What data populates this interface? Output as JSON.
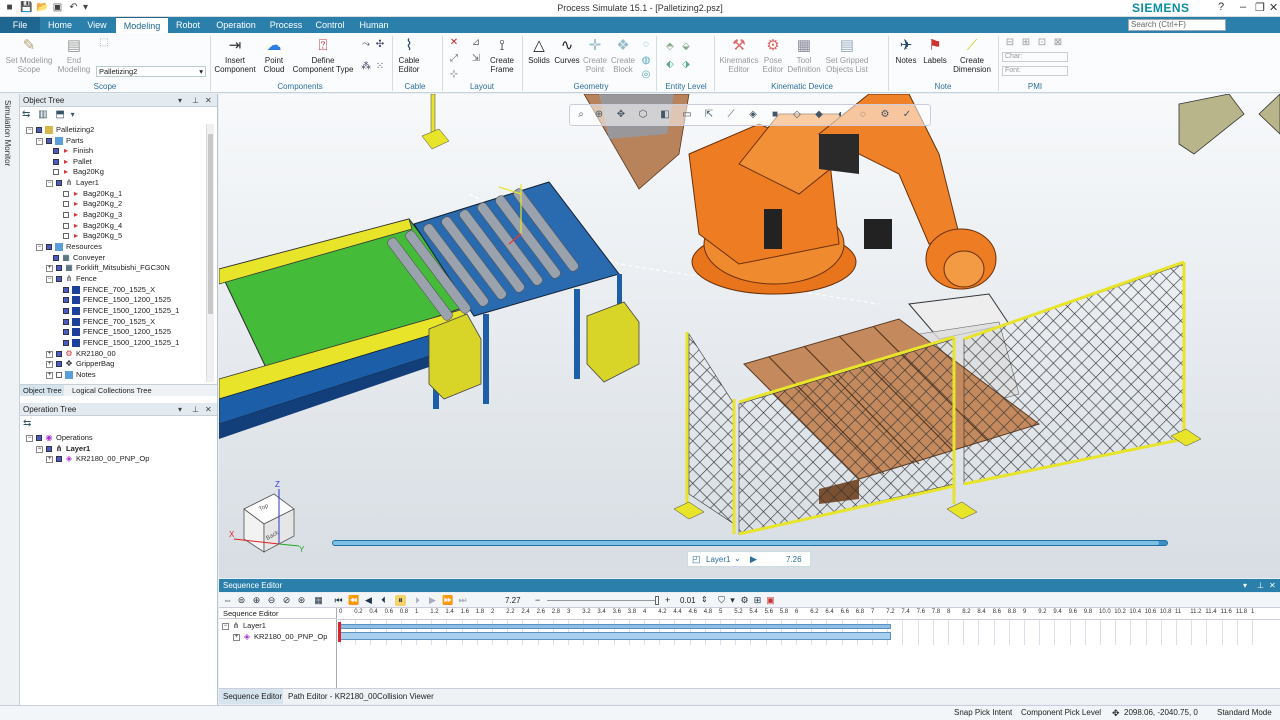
{
  "window": {
    "title": "Process Simulate 15.1 - [Palletizing2.psz]",
    "brand": "SIEMENS"
  },
  "tabs": [
    {
      "label": "File"
    },
    {
      "label": "Home"
    },
    {
      "label": "View"
    },
    {
      "label": "Modeling"
    },
    {
      "label": "Robot"
    },
    {
      "label": "Operation"
    },
    {
      "label": "Process"
    },
    {
      "label": "Control"
    },
    {
      "label": "Human"
    }
  ],
  "search": {
    "placeholder": "Search (Ctrl+F)"
  },
  "ribbon": {
    "scope": {
      "set": "Set Modeling Scope",
      "end": "End Modeling",
      "dropdown": "Palletizing2",
      "group": "Scope"
    },
    "components": {
      "insert": "Insert Component",
      "point_cloud": "Point Cloud",
      "define": "Define Component Type",
      "group": "Components"
    },
    "cable": {
      "editor": "Cable Editor",
      "group": "Cable"
    },
    "layout": {
      "create_frame": "Create Frame",
      "group": "Layout"
    },
    "geometry": {
      "solids": "Solids",
      "curves": "Curves",
      "create_point": "Create Point",
      "create_block": "Create Block",
      "group": "Geometry"
    },
    "entity": {
      "group": "Entity Level"
    },
    "kinematic": {
      "editor": "Kinematics Editor",
      "pose": "Pose Editor",
      "tool": "Tool Definition",
      "gripped": "Set Gripped Objects List",
      "group": "Kinematic Device"
    },
    "note": {
      "notes": "Notes",
      "labels": "Labels",
      "dimension": "Create Dimension",
      "group": "Note"
    },
    "pmi": {
      "char": "Char:",
      "font": "Font:",
      "group": "PMI"
    }
  },
  "side_tab": "Simulation Monitor",
  "object_tree": {
    "title": "Object Tree",
    "rows": [
      {
        "label": "Palletizing2"
      },
      {
        "label": "Parts"
      },
      {
        "label": "Finish"
      },
      {
        "label": "Pallet"
      },
      {
        "label": "Bag20Kg"
      },
      {
        "label": "Layer1"
      },
      {
        "label": "Bag20Kg_1"
      },
      {
        "label": "Bag20Kg_2"
      },
      {
        "label": "Bag20Kg_3"
      },
      {
        "label": "Bag20Kg_4"
      },
      {
        "label": "Bag20Kg_5"
      },
      {
        "label": "Resources"
      },
      {
        "label": "Conveyer"
      },
      {
        "label": "Forklift_Mitsubishi_FGC30N"
      },
      {
        "label": "Fence"
      },
      {
        "label": "FENCE_700_1525_X"
      },
      {
        "label": "FENCE_1500_1200_1525"
      },
      {
        "label": "FENCE_1500_1200_1525_1"
      },
      {
        "label": "FENCE_700_1525_X"
      },
      {
        "label": "FENCE_1500_1200_1525"
      },
      {
        "label": "FENCE_1500_1200_1525_1"
      },
      {
        "label": "KR2180_00"
      },
      {
        "label": "GripperBag"
      },
      {
        "label": "Notes"
      }
    ],
    "tabs": [
      "Object Tree",
      "Logical Collections Tree"
    ]
  },
  "operation_tree": {
    "title": "Operation Tree",
    "rows": [
      {
        "label": "Operations"
      },
      {
        "label": "Layer1"
      },
      {
        "label": "KR2180_00_PNP_Op"
      }
    ]
  },
  "viewport": {
    "sim_panel": {
      "operation": "Layer1",
      "time": "7.26"
    },
    "progress": 0.99,
    "cube_labels": {
      "top": "Top",
      "back": "Back"
    },
    "axes": {
      "x": "X",
      "y": "Y",
      "z": "Z"
    }
  },
  "sequence_editor": {
    "title": "Sequence Editor",
    "time_value": "7.27",
    "step_value": "0.01",
    "column_header": "Sequence Editor",
    "ticks": [
      "0",
      "0.2",
      "0.4",
      "0.6",
      "0.8",
      "1",
      "1.2",
      "1.4",
      "1.6",
      "1.8",
      "2",
      "2.2",
      "2.4",
      "2.6",
      "2.8",
      "3",
      "3.2",
      "3.4",
      "3.6",
      "3.8",
      "4",
      "4.2",
      "4.4",
      "4.6",
      "4.8",
      "5",
      "5.2",
      "5.4",
      "5.6",
      "5.8",
      "6",
      "6.2",
      "6.4",
      "6.6",
      "6.8",
      "7",
      "7.2",
      "7.4",
      "7.6",
      "7.8",
      "8",
      "8.2",
      "8.4",
      "8.6",
      "8.8",
      "9",
      "9.2",
      "9.4",
      "9.6",
      "9.8",
      "10.0",
      "10.2",
      "10.4",
      "10.6",
      "10.8",
      "11",
      "11.2",
      "11.4",
      "11.6",
      "11.8",
      "1"
    ],
    "rows": [
      {
        "label": "Layer1"
      },
      {
        "label": "KR2180_00_PNP_Op"
      }
    ],
    "bar_end_time": 7.27,
    "tabs": [
      "Sequence Editor",
      "Path Editor - KR2180_00",
      "Collision Viewer"
    ]
  },
  "status": {
    "snap": "Snap Pick Intent",
    "pick": "Component Pick Level",
    "coords": "2098.06, -2040.75, 0",
    "mode": "Standard Mode"
  },
  "colors": {
    "accent": "#2b7fab",
    "robot": "#e8741c",
    "fence": "#e8e42a",
    "conveyor": "#1c5fa8"
  }
}
